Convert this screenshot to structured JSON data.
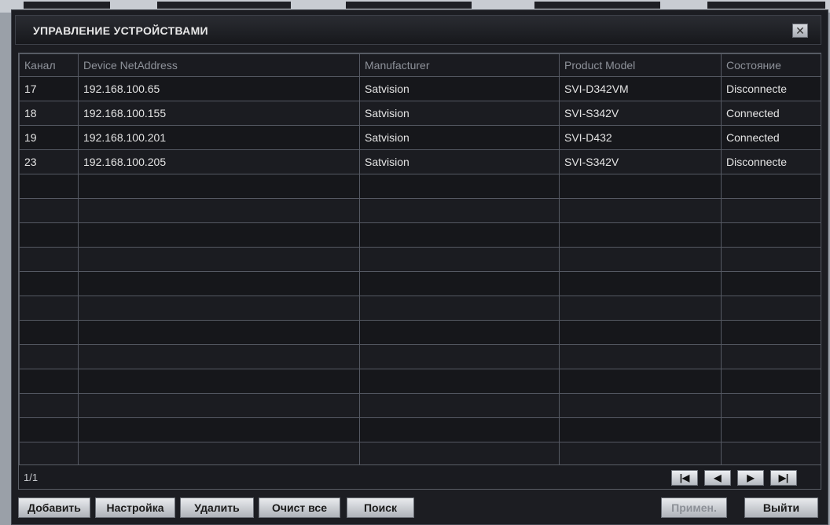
{
  "window": {
    "title": "УПРАВЛЕНИЕ УСТРОЙСТВАМИ",
    "close_icon": "close-icon"
  },
  "table": {
    "headers": [
      "Канал",
      "Device NetAddress",
      "Manufacturer",
      "Product Model",
      "Состояние"
    ],
    "rows": [
      [
        "17",
        "192.168.100.65",
        "Satvision",
        "SVI-D342VM",
        "Disconnecte"
      ],
      [
        "18",
        "192.168.100.155",
        "Satvision",
        "SVI-S342V",
        "Connected"
      ],
      [
        "19",
        "192.168.100.201",
        "Satvision",
        "SVI-D432",
        "Connected"
      ],
      [
        "23",
        "192.168.100.205",
        "Satvision",
        "SVI-S342V",
        "Disconnecte"
      ]
    ],
    "empty_rows": 12
  },
  "pager": {
    "page": "1/1",
    "nav_icons": [
      "first-page-icon",
      "prev-page-icon",
      "next-page-icon",
      "last-page-icon"
    ]
  },
  "buttons": {
    "add": "Добавить",
    "settings": "Настройка",
    "delete": "Удалить",
    "clear_all": "Очист все",
    "search": "Поиск",
    "apply": "Примен.",
    "exit": "Выйти"
  }
}
